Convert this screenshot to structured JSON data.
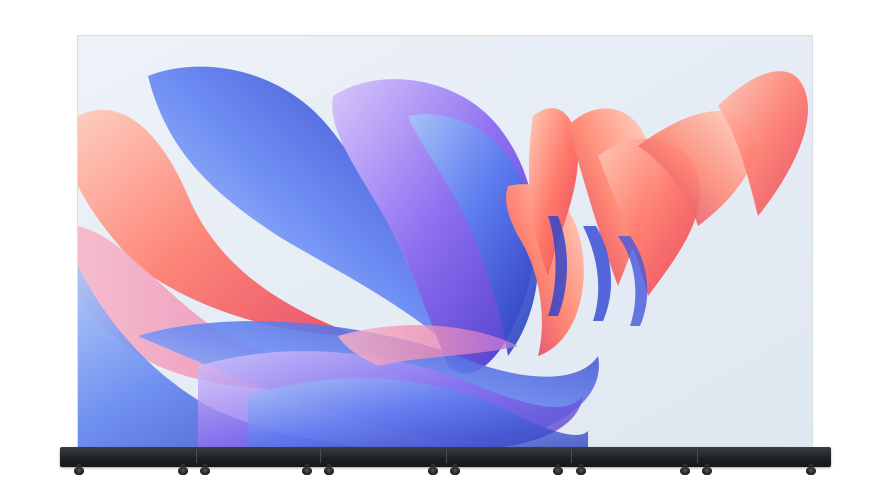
{
  "image": {
    "subject": "tv-display",
    "colors": {
      "background": "#ffffff",
      "screen_bg": "#e8eef5",
      "petal_blue": "#3a5bd9",
      "petal_coral": "#f26b5b",
      "petal_pink": "#f7a3b8",
      "stand": "#1e2024"
    }
  }
}
